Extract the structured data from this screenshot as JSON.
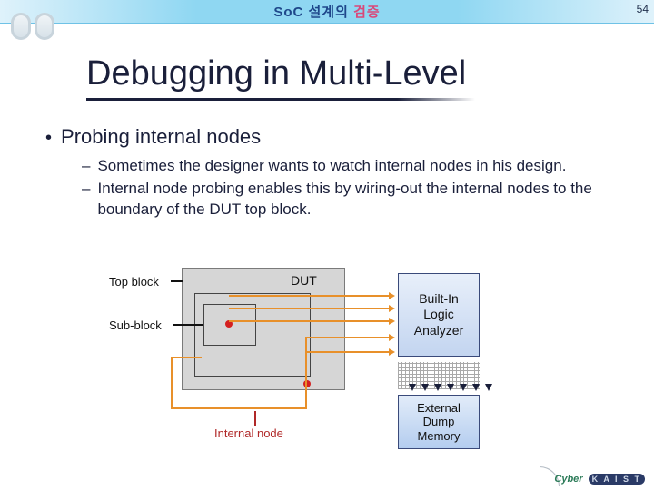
{
  "page_number": "54",
  "header": {
    "soc": "SoC",
    "mid": " 설계의 ",
    "last": "검증"
  },
  "title": "Debugging in Multi-Level",
  "bullets": {
    "main": "Probing internal nodes",
    "sub1": "Sometimes the designer wants to watch internal nodes in his design.",
    "sub2": "Internal node probing enables this by wiring-out the internal nodes to the boundary of the DUT top block."
  },
  "diagram": {
    "top_block": "Top block",
    "sub_block": "Sub-block",
    "dut": "DUT",
    "internal_node": "Internal node",
    "bila": "Built-In\nLogic\nAnalyzer",
    "ext": "External\nDump\nMemory"
  },
  "footer": {
    "cyber": "Cyber",
    "kaist": "K A I S T"
  }
}
